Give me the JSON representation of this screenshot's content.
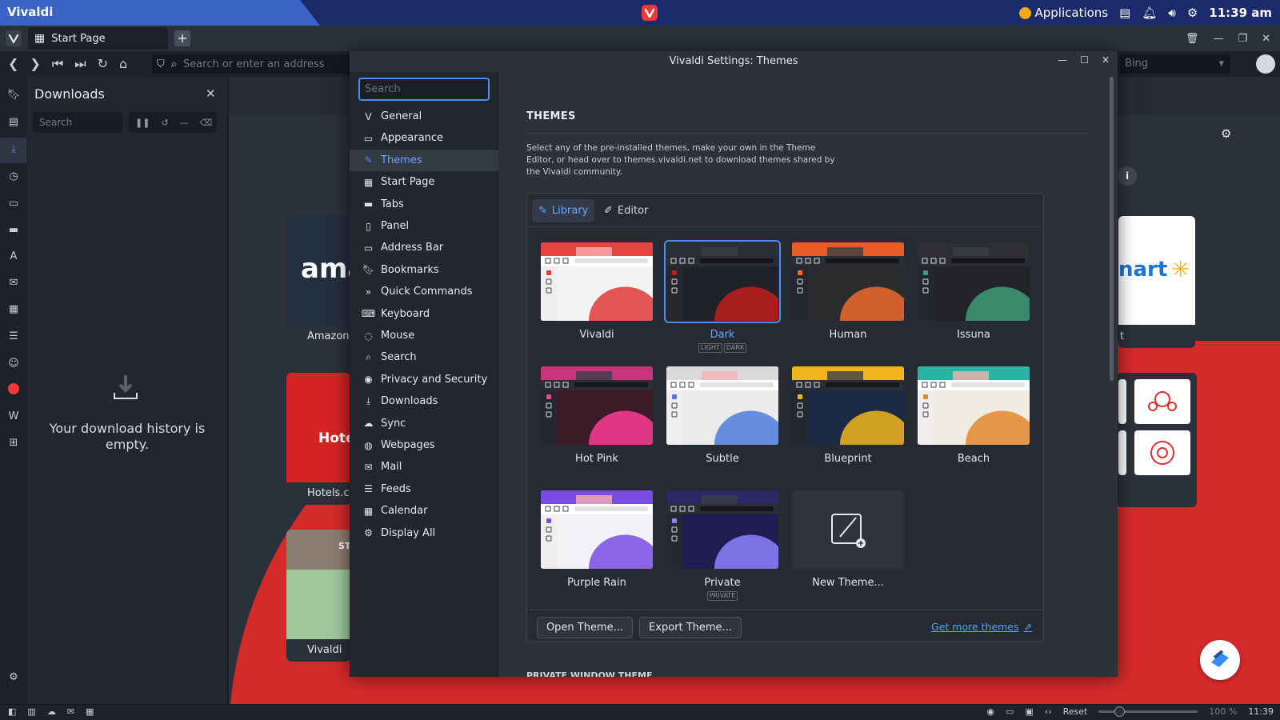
{
  "os": {
    "app_title": "Vivaldi",
    "applications_label": "Applications",
    "clock": "11:39 am"
  },
  "browser": {
    "tab_title": "Start Page",
    "address_placeholder": "Search or enter an address",
    "search_engine_placeholder": "Bing"
  },
  "downloads_panel": {
    "title": "Downloads",
    "search_placeholder": "Search",
    "empty_message": "Your download history is empty."
  },
  "speed_dials": [
    {
      "label": "Amazon",
      "logo_text": "ama"
    },
    {
      "label": "Hotels.co",
      "logo_text": "Hote"
    },
    {
      "label": "Vivaldi G",
      "logo_text": "ST"
    }
  ],
  "speed_dial_right": {
    "logo_text": "nart",
    "label_fragment": "t"
  },
  "settings": {
    "window_title": "Vivaldi Settings: Themes",
    "search_placeholder": "Search",
    "nav": [
      {
        "label": "General",
        "icon": "vivaldi-v-icon"
      },
      {
        "label": "Appearance",
        "icon": "folder-icon"
      },
      {
        "label": "Themes",
        "icon": "brush-icon",
        "active": true
      },
      {
        "label": "Start Page",
        "icon": "grid-icon"
      },
      {
        "label": "Tabs",
        "icon": "tabs-icon"
      },
      {
        "label": "Panel",
        "icon": "panel-icon"
      },
      {
        "label": "Address Bar",
        "icon": "address-bar-icon"
      },
      {
        "label": "Bookmarks",
        "icon": "bookmark-icon"
      },
      {
        "label": "Quick Commands",
        "icon": "quick-commands-icon"
      },
      {
        "label": "Keyboard",
        "icon": "keyboard-icon"
      },
      {
        "label": "Mouse",
        "icon": "mouse-icon"
      },
      {
        "label": "Search",
        "icon": "search-icon"
      },
      {
        "label": "Privacy and Security",
        "icon": "eye-icon"
      },
      {
        "label": "Downloads",
        "icon": "download-icon"
      },
      {
        "label": "Sync",
        "icon": "cloud-icon"
      },
      {
        "label": "Webpages",
        "icon": "globe-icon"
      },
      {
        "label": "Mail",
        "icon": "mail-icon"
      },
      {
        "label": "Feeds",
        "icon": "rss-icon"
      },
      {
        "label": "Calendar",
        "icon": "calendar-icon"
      },
      {
        "label": "Display All",
        "icon": "gear-icon"
      }
    ],
    "section_title": "THEMES",
    "description": "Select any of the pre-installed themes, make your own in the Theme Editor, or head over to themes.vivaldi.net to download themes shared by the Vivaldi community.",
    "library_tab": "Library",
    "editor_tab": "Editor",
    "themes": [
      {
        "name": "Vivaldi",
        "bg": "#f3f3f3",
        "accent": "#e03a3a",
        "top": "#e84343",
        "dark": false
      },
      {
        "name": "Dark",
        "bg": "#1f2229",
        "accent": "#c11c1c",
        "top": "#2a2e36",
        "dark": true,
        "selected": true,
        "tags": [
          "LIGHT",
          "DARK"
        ]
      },
      {
        "name": "Human",
        "bg": "#2b2c2e",
        "accent": "#ee6b2b",
        "top": "#e85b24",
        "dark": true
      },
      {
        "name": "Issuna",
        "bg": "#222427",
        "accent": "#3d9b77",
        "top": "#2d2f33",
        "dark": true
      },
      {
        "name": "Hot Pink",
        "bg": "#3a1a26",
        "accent": "#ff3c96",
        "top": "#c9357a",
        "dark": true
      },
      {
        "name": "Subtle",
        "bg": "#ebebeb",
        "accent": "#4f7cdc",
        "top": "#dadada",
        "dark": false
      },
      {
        "name": "Blueprint",
        "bg": "#1a2a44",
        "accent": "#f1b51c",
        "top": "#f1b51c",
        "dark": true
      },
      {
        "name": "Beach",
        "bg": "#f1ece1",
        "accent": "#e28a2b",
        "top": "#2ab2a2",
        "dark": false
      },
      {
        "name": "Purple Rain",
        "bg": "#f2f2f6",
        "accent": "#7a4be3",
        "top": "#7a4be3",
        "dark": false
      },
      {
        "name": "Private",
        "bg": "#1f1d4f",
        "accent": "#8a82ff",
        "top": "#2b2866",
        "dark": true,
        "tags": [
          "PRIVATE"
        ]
      },
      {
        "name": "New Theme...",
        "new": true
      }
    ],
    "open_theme_button": "Open Theme...",
    "export_theme_button": "Export Theme...",
    "get_more_link": "Get more themes",
    "next_section_title": "PRIVATE WINDOW THEME"
  },
  "statusbar": {
    "reset_label": "Reset",
    "zoom": "100 %",
    "time": "11:39"
  },
  "colors": {
    "accent": "#4b8df0",
    "vivaldi_red": "#ef3939",
    "settings_bg": "#2c313a"
  }
}
